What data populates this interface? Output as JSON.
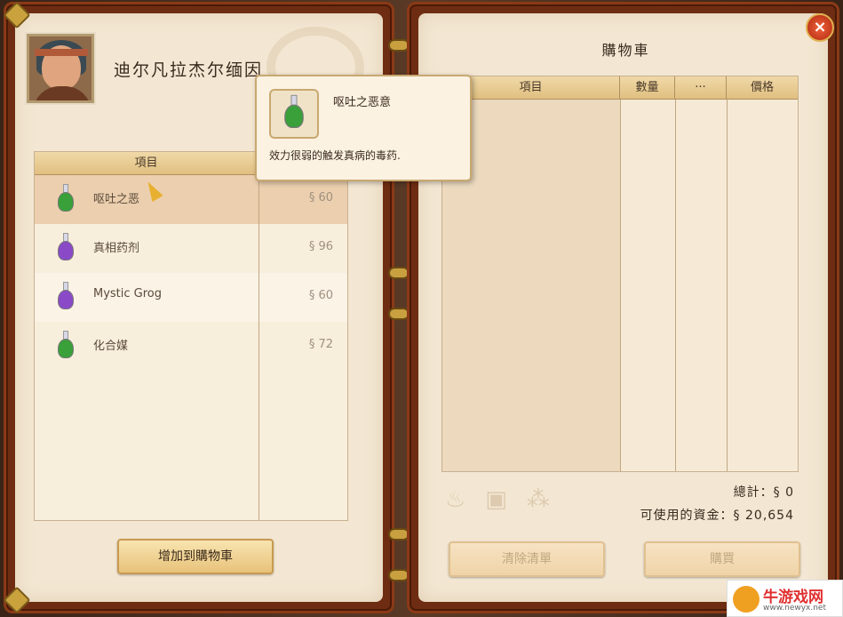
{
  "shop": {
    "name": "迪尔凡拉杰尔缅因",
    "list_header": "項目",
    "add_to_cart": "增加到購物車",
    "items": [
      {
        "name": "呕吐之恶",
        "price": "§ 60",
        "color": "#3aa03a",
        "selected": true
      },
      {
        "name": "真相药剂",
        "price": "§ 96",
        "color": "#8a4ac8"
      },
      {
        "name": "Mystic Grog",
        "price": "§ 60",
        "color": "#8a4ac8"
      },
      {
        "name": "化合媒",
        "price": "§ 72",
        "color": "#3aa03a"
      }
    ]
  },
  "tooltip": {
    "title": "呕吐之恶意",
    "desc": "效力很弱的触发真病的毒药."
  },
  "cart": {
    "title": "購物車",
    "headers": [
      "項目",
      "數量",
      "···",
      "價格"
    ],
    "total": "總計：§ 0",
    "funds": "可使用的資金：§ 20,654",
    "clear": "清除清單",
    "buy": "購買"
  },
  "watermark": {
    "main": "牛游戏网",
    "sub": "www.newyx.net"
  }
}
